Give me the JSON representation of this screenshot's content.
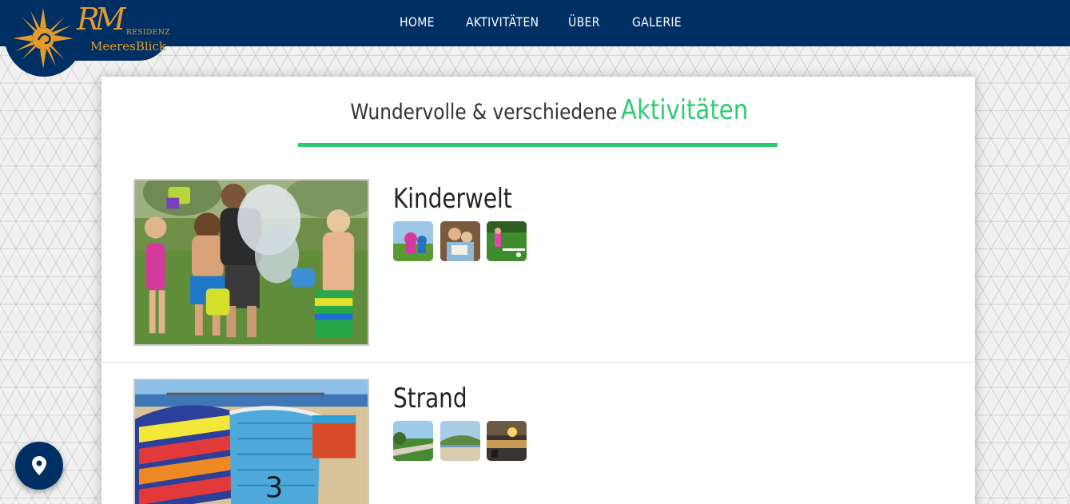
{
  "logo": {
    "monogram": "RM",
    "residenz": "RESIDENZ",
    "name": "MeeresBlick",
    "icon": "sun-icon"
  },
  "nav": {
    "items": [
      {
        "label": "HOME"
      },
      {
        "label": "AKTIVITÄTEN"
      },
      {
        "label": "ÜBER"
      },
      {
        "label": "GALERIE"
      }
    ]
  },
  "headline": {
    "plain": "Wundervolle & verschiedene",
    "accent": "Aktivitäten"
  },
  "sections": [
    {
      "title": "Kinderwelt",
      "photo": "children-water-play-photo",
      "thumbnails": [
        "kids-playground-thumb",
        "kids-reading-thumb",
        "kids-lawn-thumb"
      ]
    },
    {
      "title": "Strand",
      "photo": "beach-chairs-pier-photo",
      "thumbnails": [
        "promenade-thumb",
        "beach-cliff-thumb",
        "sunset-thumb"
      ]
    }
  ],
  "location_button": {
    "icon": "map-pin-icon"
  },
  "colors": {
    "header": "#002f63",
    "accent_green": "#2ecc71",
    "logo_gold": "#e49b2e",
    "card": "#ffffff"
  }
}
